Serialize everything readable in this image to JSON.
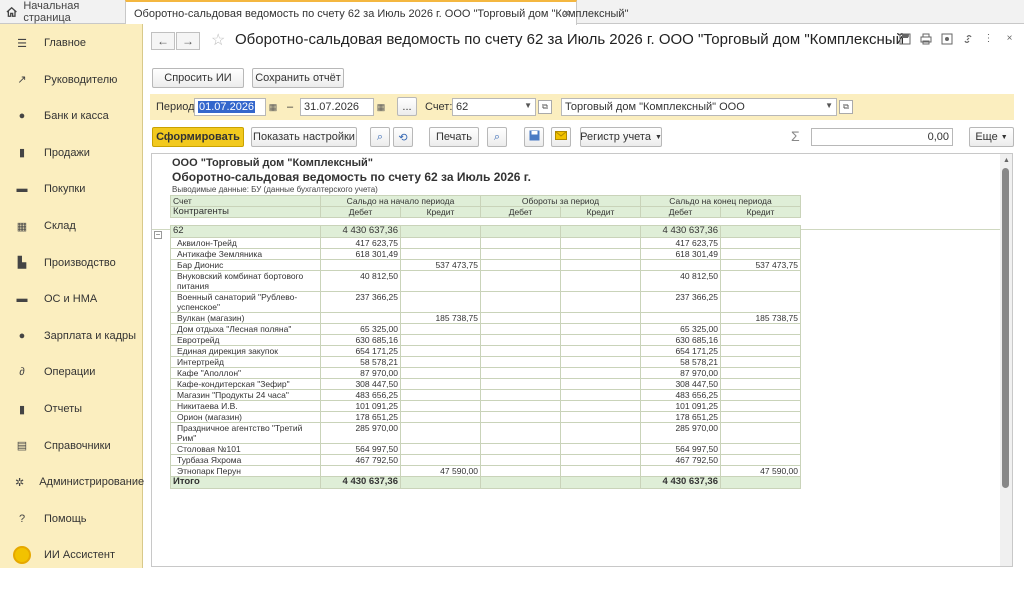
{
  "tabs": {
    "home": "Начальная страница",
    "active": "Оборотно-сальдовая ведомость по счету 62 за Июль 2026 г. ООО \"Торговый дом \"Комплексный\"",
    "close": "×"
  },
  "sidebar": {
    "items": [
      {
        "label": "Главное",
        "icon": "menu-icon"
      },
      {
        "label": "Руководителю",
        "icon": "chart-line-icon"
      },
      {
        "label": "Банк и касса",
        "icon": "ruble-coin-icon"
      },
      {
        "label": "Продажи",
        "icon": "shopping-bag-icon"
      },
      {
        "label": "Покупки",
        "icon": "cart-icon"
      },
      {
        "label": "Склад",
        "icon": "warehouse-icon"
      },
      {
        "label": "Производство",
        "icon": "factory-icon"
      },
      {
        "label": "ОС и НМА",
        "icon": "truck-icon"
      },
      {
        "label": "Зарплата и кадры",
        "icon": "person-icon"
      },
      {
        "label": "Операции",
        "icon": "dt-kt-icon"
      },
      {
        "label": "Отчеты",
        "icon": "bar-chart-icon"
      },
      {
        "label": "Справочники",
        "icon": "book-icon"
      },
      {
        "label": "Администрирование",
        "icon": "gear-icon"
      },
      {
        "label": "Помощь",
        "icon": "help-icon"
      },
      {
        "label": "ИИ Ассистент",
        "icon": "ai-assistant-icon"
      }
    ]
  },
  "header": {
    "back": "←",
    "forward": "→",
    "star": "☆",
    "title": "Оборотно-сальдовая ведомость по счету 62 за Июль 2026 г. ООО \"Торговый дом \"Комплексный\"",
    "more": "⋮",
    "close": "×"
  },
  "toolbar1": {
    "ask_ai": "Спросить ИИ",
    "save_report": "Сохранить отчёт"
  },
  "params": {
    "period_label": "Период:",
    "date_from": "01.07.2026",
    "dash": "–",
    "date_to": "31.07.2026",
    "dots": "...",
    "account_label": "Счет:",
    "account": "62",
    "org": "Торговый дом \"Комплексный\" ООО"
  },
  "toolbar2": {
    "generate": "Сформировать",
    "show_settings": "Показать настройки",
    "print": "Печать",
    "registry": "Регистр учета",
    "sum_symbol": "Σ",
    "sum_value": "0,00",
    "more": "Еще"
  },
  "report": {
    "org": "ООО \"Торговый дом \"Комплексный\"",
    "title": "Оборотно-сальдовая ведомость по счету 62 за Июль 2026 г.",
    "subtitle": "Выводимые данные: БУ (данные бухгалтерского учета)",
    "headers": {
      "account": "Счет",
      "counterparties": "Контрагенты",
      "opening": "Сальдо на начало периода",
      "turnover": "Обороты за период",
      "closing": "Сальдо на конец периода",
      "debit": "Дебет",
      "credit": "Кредит"
    },
    "group": {
      "name": "62",
      "open_debit": "4 430 637,36",
      "open_credit": "",
      "turn_debit": "",
      "turn_credit": "",
      "close_debit": "4 430 637,36",
      "close_credit": ""
    },
    "rows": [
      [
        "Аквилон-Трейд",
        "417 623,75",
        "",
        "",
        "",
        "417 623,75",
        ""
      ],
      [
        "Антикафе Земляника",
        "618 301,49",
        "",
        "",
        "",
        "618 301,49",
        ""
      ],
      [
        "Бар Дионис",
        "",
        "537 473,75",
        "",
        "",
        "",
        "537 473,75"
      ],
      [
        "Внуковский комбинат бортового питания",
        "40 812,50",
        "",
        "",
        "",
        "40 812,50",
        ""
      ],
      [
        "Военный санаторий \"Рублево-успенское\"",
        "237 366,25",
        "",
        "",
        "",
        "237 366,25",
        ""
      ],
      [
        "Вулкан (магазин)",
        "",
        "185 738,75",
        "",
        "",
        "",
        "185 738,75"
      ],
      [
        "Дом отдыха \"Лесная поляна\"",
        "65 325,00",
        "",
        "",
        "",
        "65 325,00",
        ""
      ],
      [
        "Евротрейд",
        "630 685,16",
        "",
        "",
        "",
        "630 685,16",
        ""
      ],
      [
        "Единая дирекция закупок",
        "654 171,25",
        "",
        "",
        "",
        "654 171,25",
        ""
      ],
      [
        "Интертрейд",
        "58 578,21",
        "",
        "",
        "",
        "58 578,21",
        ""
      ],
      [
        "Кафе \"Аполлон\"",
        "87 970,00",
        "",
        "",
        "",
        "87 970,00",
        ""
      ],
      [
        "Кафе-кондитерская \"Зефир\"",
        "308 447,50",
        "",
        "",
        "",
        "308 447,50",
        ""
      ],
      [
        "Магазин \"Продукты 24 часа\"",
        "483 656,25",
        "",
        "",
        "",
        "483 656,25",
        ""
      ],
      [
        "Никитаева И.В.",
        "101 091,25",
        "",
        "",
        "",
        "101 091,25",
        ""
      ],
      [
        "Орион (магазин)",
        "178 651,25",
        "",
        "",
        "",
        "178 651,25",
        ""
      ],
      [
        "Праздничное агентство \"Третий Рим\"",
        "285 970,00",
        "",
        "",
        "",
        "285 970,00",
        ""
      ],
      [
        "Столовая №101",
        "564 997,50",
        "",
        "",
        "",
        "564 997,50",
        ""
      ],
      [
        "Турбаза Яхрома",
        "467 792,50",
        "",
        "",
        "",
        "467 792,50",
        ""
      ],
      [
        "Этнопарк Перун",
        "",
        "47 590,00",
        "",
        "",
        "",
        "47 590,00"
      ]
    ],
    "total": {
      "name": "Итого",
      "open_debit": "4 430 637,36",
      "open_credit": "",
      "turn_debit": "",
      "turn_credit": "",
      "close_debit": "4 430 637,36",
      "close_credit": ""
    }
  }
}
